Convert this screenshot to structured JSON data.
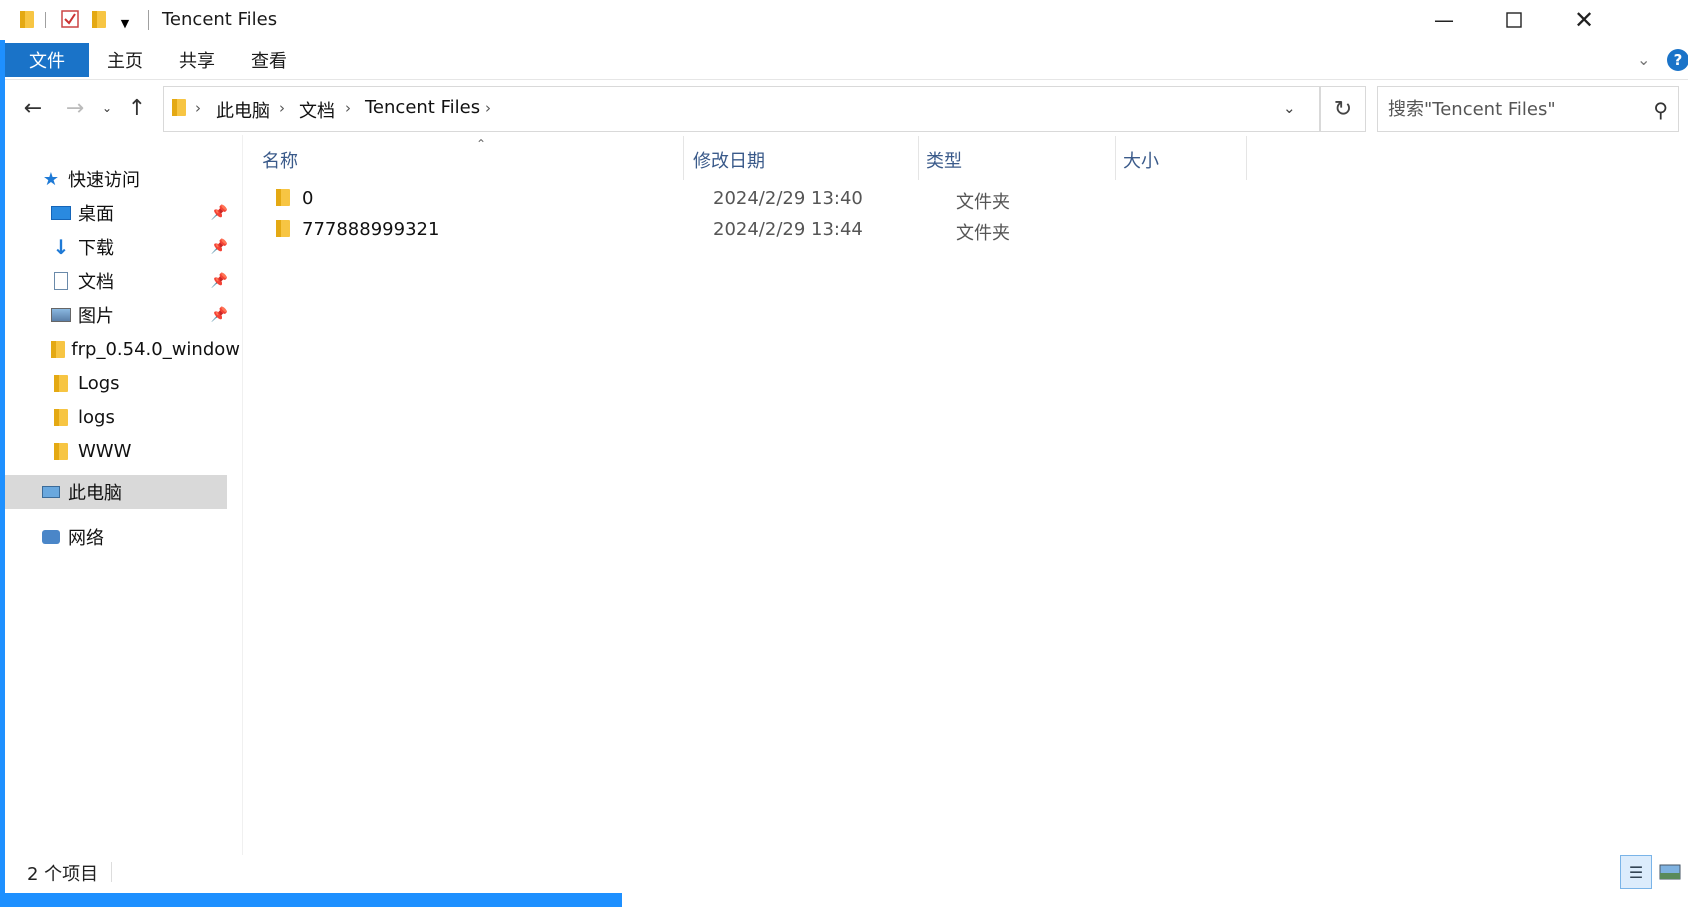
{
  "window": {
    "title": "Tencent Files"
  },
  "ribbon": {
    "tabs": [
      "文件",
      "主页",
      "共享",
      "查看"
    ],
    "help": "?"
  },
  "address": {
    "breadcrumb": [
      "此电脑",
      "文档",
      "Tencent Files"
    ]
  },
  "search": {
    "placeholder": "搜索\"Tencent Files\""
  },
  "sidebar": {
    "quick_access": "快速访问",
    "items": [
      {
        "label": "桌面",
        "icon": "desktop-icon",
        "pinned": true
      },
      {
        "label": "下载",
        "icon": "download-arrow-icon",
        "pinned": true
      },
      {
        "label": "文档",
        "icon": "document-icon",
        "pinned": true
      },
      {
        "label": "图片",
        "icon": "picture-icon",
        "pinned": true
      },
      {
        "label": "frp_0.54.0_window",
        "icon": "folder-icon",
        "pinned": false
      },
      {
        "label": "Logs",
        "icon": "folder-icon",
        "pinned": false
      },
      {
        "label": "logs",
        "icon": "folder-icon",
        "pinned": false
      },
      {
        "label": "WWW",
        "icon": "folder-icon",
        "pinned": false
      }
    ],
    "this_pc": "此电脑",
    "network": "网络"
  },
  "columns": [
    "名称",
    "修改日期",
    "类型",
    "大小"
  ],
  "files": [
    {
      "name": "0",
      "modified": "2024/2/29 13:40",
      "type": "文件夹",
      "size": ""
    },
    {
      "name": "777888999321",
      "modified": "2024/2/29 13:44",
      "type": "文件夹",
      "size": ""
    }
  ],
  "status": {
    "item_count": "2 个项目"
  },
  "colors": {
    "accent": "#1a73c8",
    "folder": "#f7c543",
    "selected_nav": "#d9d9d9"
  }
}
